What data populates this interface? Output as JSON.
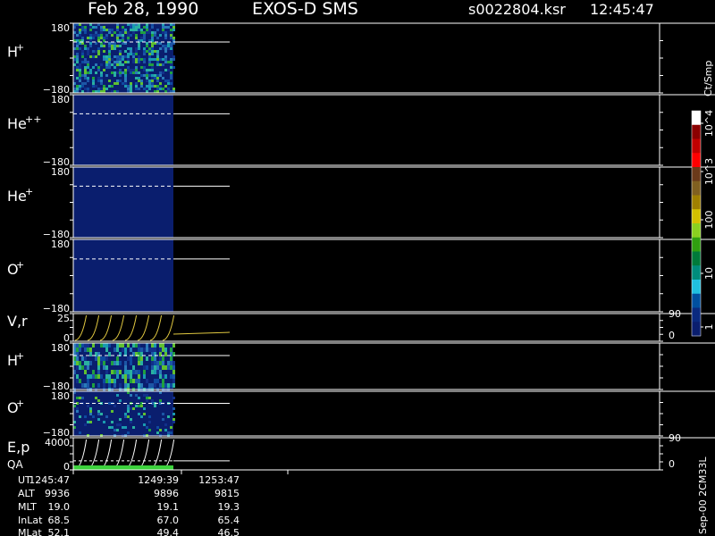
{
  "header": {
    "date": "Feb 28, 1990",
    "instrument": "EXOS-D SMS",
    "file": "s0022804.ksr",
    "time": "12:45:47"
  },
  "colorbar": {
    "unit": "Ct/Smp",
    "tick_labels": [
      "10^4",
      "10^3",
      "100",
      "10",
      "1"
    ],
    "colors": [
      "#ffffff",
      "#8b0000",
      "#c00000",
      "#ff0000",
      "#6b3a1a",
      "#806020",
      "#a08000",
      "#d4c000",
      "#8ad020",
      "#30a010",
      "#007a3a",
      "#008c7c",
      "#20c0e0",
      "#0050a0",
      "#0a2a80",
      "#0a1e6e"
    ]
  },
  "chart_data": [
    {
      "type": "heatmap",
      "label": "H",
      "superscript": "+",
      "ymin": "−180",
      "ymax": "180",
      "ylim": [
        -180,
        180
      ],
      "pattern": "dense",
      "filled_fraction": 0.17
    },
    {
      "type": "heatmap",
      "label": "He",
      "superscript": "++",
      "ymin": "−180",
      "ymax": "180",
      "ylim": [
        -180,
        180
      ],
      "pattern": "flat",
      "filled_fraction": 0.17
    },
    {
      "type": "heatmap",
      "label": "He",
      "superscript": "+",
      "ymin": "−180",
      "ymax": "180",
      "ylim": [
        -180,
        180
      ],
      "pattern": "flat",
      "filled_fraction": 0.17
    },
    {
      "type": "heatmap",
      "label": "O",
      "superscript": "+",
      "ymin": "−180",
      "ymax": "180",
      "ylim": [
        -180,
        180
      ],
      "pattern": "flat",
      "filled_fraction": 0.17
    },
    {
      "type": "line",
      "label": "V,r",
      "ymin": "0",
      "ymax": "25",
      "ylim": [
        0,
        25
      ],
      "right_ymin": "0",
      "right_ymax": "90",
      "right_ylim": [
        0,
        90
      ]
    },
    {
      "type": "heatmap",
      "label": "H",
      "superscript": "+",
      "ymin": "−180",
      "ymax": "180",
      "ylim": [
        -180,
        180
      ],
      "pattern": "stripes",
      "filled_fraction": 0.17
    },
    {
      "type": "heatmap",
      "label": "O",
      "superscript": "+",
      "ymin": "−180",
      "ymax": "180",
      "ylim": [
        -180,
        180
      ],
      "pattern": "sparse",
      "filled_fraction": 0.17
    },
    {
      "type": "line",
      "label": "E,p",
      "label2": "QA",
      "ymin": "0",
      "ymax": "4000",
      "ylim": [
        0,
        4000
      ],
      "right_ymin": "0",
      "right_ymax": "90",
      "right_ylim": [
        0,
        90
      ]
    }
  ],
  "time_axis": {
    "row_labels": [
      "UT",
      "ALT",
      "MLT",
      "InLat",
      "MLat"
    ],
    "columns": [
      {
        "values": [
          "1245:47",
          "9936",
          "19.0",
          "68.5",
          "52.1"
        ]
      },
      {
        "values": [
          "1249:39",
          "9896",
          "19.1",
          "67.0",
          "49.4"
        ]
      },
      {
        "values": [
          "1253:47",
          "9815",
          "19.3",
          "65.4",
          "46.5"
        ]
      }
    ]
  },
  "footer_label": "Sep-00 2CM33L"
}
